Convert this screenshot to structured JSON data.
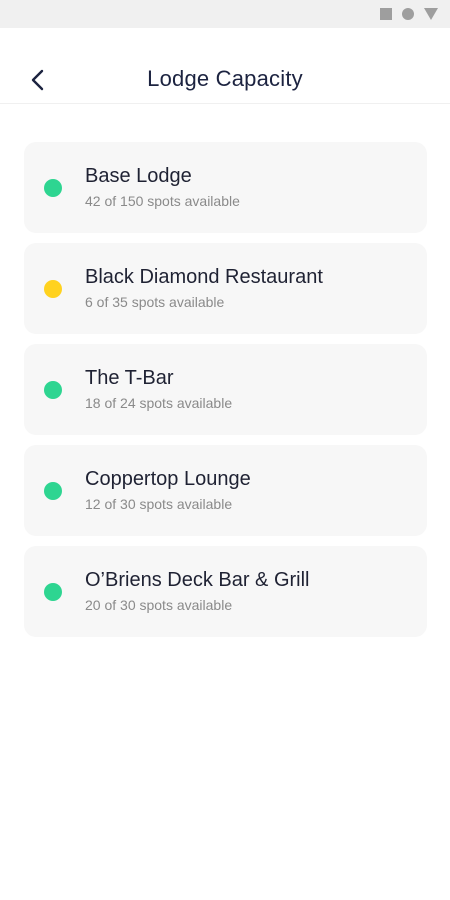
{
  "status_bar": {
    "icons": [
      "square-icon",
      "circle-icon",
      "triangle-icon"
    ]
  },
  "header": {
    "back_icon": "chevron-left-icon",
    "title": "Lodge Capacity"
  },
  "colors": {
    "available": "#2ed591",
    "limited": "#ffd21f",
    "title_text": "#1c2340",
    "card_bg": "#f7f7f7",
    "sub_text": "#8a8a8a"
  },
  "lodges": [
    {
      "name": "Base Lodge",
      "availability": "42 of 150 spots available",
      "status": "available"
    },
    {
      "name": "Black Diamond Restaurant",
      "availability": "6 of 35 spots available",
      "status": "limited"
    },
    {
      "name": "The T-Bar",
      "availability": "18 of 24 spots available",
      "status": "available"
    },
    {
      "name": "Coppertop Lounge",
      "availability": "12 of 30 spots available",
      "status": "available"
    },
    {
      "name": "O’Briens Deck Bar & Grill",
      "availability": "20 of 30 spots available",
      "status": "available"
    }
  ]
}
